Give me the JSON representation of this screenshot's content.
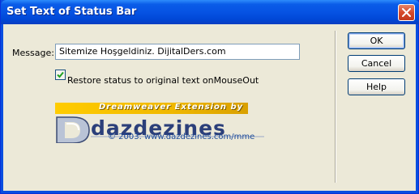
{
  "window": {
    "title": "Set Text of Status Bar"
  },
  "form": {
    "message_label": "Message:",
    "message_value": "Sitemize Hoşgeldiniz. DijitalDers.com",
    "restore_checked": true,
    "restore_label": "Restore status to original text onMouseOut"
  },
  "branding": {
    "banner_text": "Dreamweaver Extension by",
    "logo_text": "dazdezines",
    "copyright": "© 2003. www.dazdezines.com/mme"
  },
  "buttons": {
    "ok": "OK",
    "cancel": "Cancel",
    "help": "Help"
  },
  "colors": {
    "titlebar": "#0a5ce8",
    "close_button": "#d6492a",
    "banner": "#ffcc00",
    "logo": "#2b3f7a",
    "checkmark": "#21a121"
  }
}
